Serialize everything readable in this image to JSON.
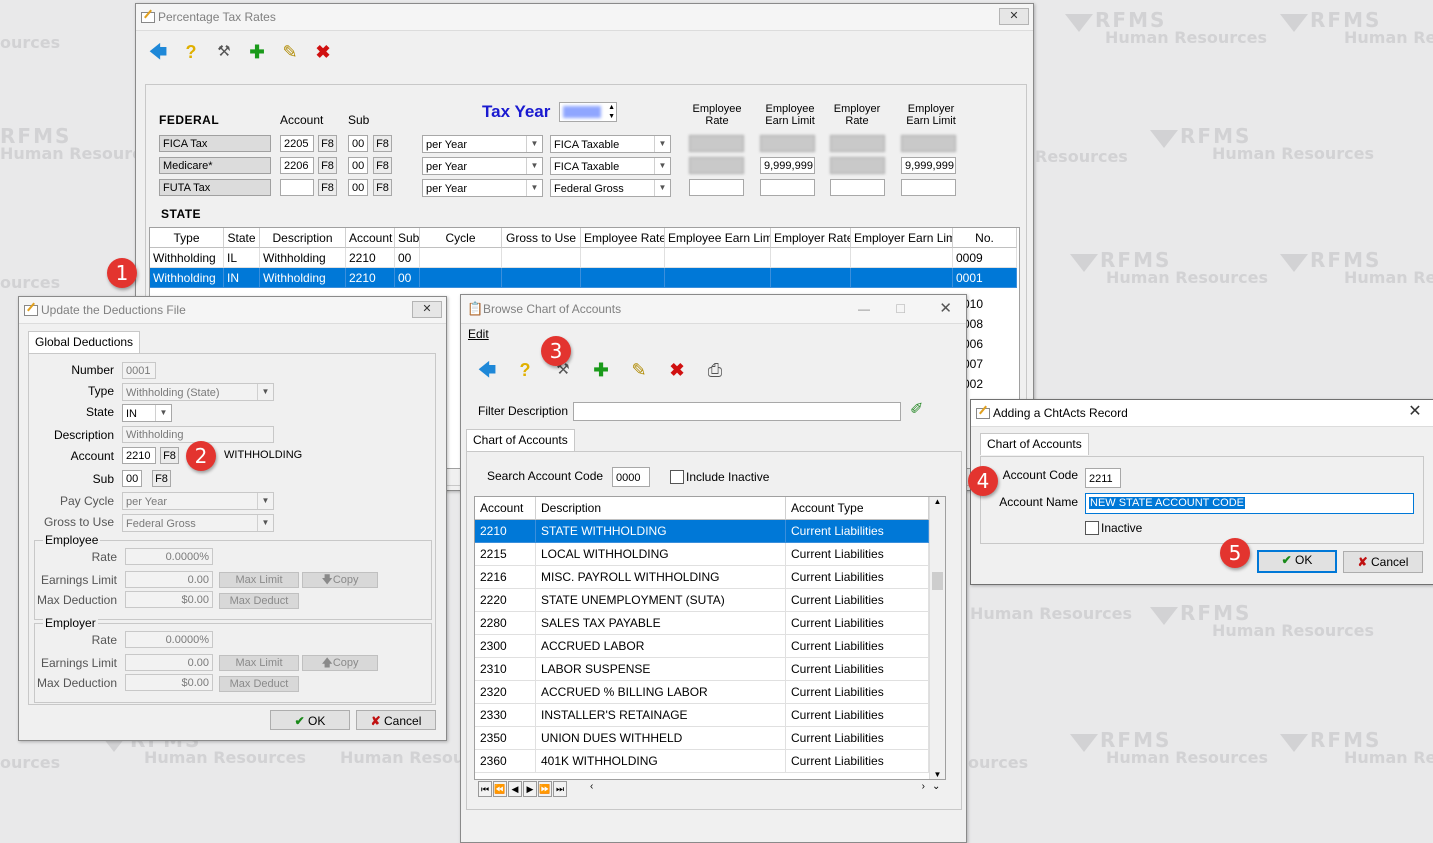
{
  "watermark": {
    "logo": "RFMS",
    "sub": "Human Resources",
    "sub_cut_left": "ources",
    "sub_cut_mid": "Resources",
    "sub_cut_right": "Human Res"
  },
  "tax_window": {
    "title": "Percentage Tax Rates",
    "federal": {
      "heading": "FEDERAL",
      "col_account": "Account",
      "col_sub": "Sub",
      "tax_year_label": "Tax Year",
      "col_emp_rate": "Employee Rate",
      "col_emp_earn": "Employee Earn Limit",
      "col_er_rate": "Employer Rate",
      "col_er_earn": "Employer Earn Limit",
      "f8": "F8",
      "rows": [
        {
          "name": "FICA Tax",
          "account": "2205",
          "sub": "00",
          "cycle": "per Year",
          "gross": "FICA Taxable",
          "emp_earn": "",
          "er_earn": ""
        },
        {
          "name": "Medicare*",
          "account": "2206",
          "sub": "00",
          "cycle": "per Year",
          "gross": "FICA Taxable",
          "emp_earn": "9,999,999",
          "er_earn": "9,999,999"
        },
        {
          "name": "FUTA Tax",
          "account": "",
          "sub": "00",
          "cycle": "per Year",
          "gross": "Federal Gross",
          "emp_earn": "",
          "er_earn": ""
        }
      ]
    },
    "state": {
      "heading": "STATE",
      "columns": [
        "Type",
        "State",
        "Description",
        "Account",
        "Sub",
        "Cycle",
        "Gross to Use",
        "Employee Rate",
        "Employee Earn Limit",
        "Employer Rate",
        "Employer Earn Limit",
        "No."
      ],
      "rows": [
        {
          "type": "Withholding",
          "state": "IL",
          "desc": "Withholding",
          "account": "2210",
          "sub": "00",
          "no": "0009"
        },
        {
          "type": "Withholding",
          "state": "IN",
          "desc": "Withholding",
          "account": "2210",
          "sub": "00",
          "no": "0001"
        }
      ],
      "partial_nos": [
        "010",
        "008",
        "006",
        "007",
        "002"
      ],
      "partial_left": "W"
    }
  },
  "deductions_window": {
    "title": "Update the Deductions File",
    "tab": "Global Deductions",
    "number_label": "Number",
    "number": "0001",
    "type_label": "Type",
    "type": "Withholding (State)",
    "state_label": "State",
    "state": "IN",
    "description_label": "Description",
    "description": "Withholding",
    "account_label": "Account",
    "account": "2210",
    "account_name": "WITHHOLDING",
    "sub_label": "Sub",
    "sub": "00",
    "pay_cycle_label": "Pay Cycle",
    "pay_cycle": "per Year",
    "gross_label": "Gross to Use",
    "gross": "Federal Gross",
    "employee_group": "Employee",
    "employer_group": "Employer",
    "rate_label": "Rate",
    "rate": "0.0000%",
    "earn_label": "Earnings Limit",
    "earn": "0.00",
    "maxded_label": "Max Deduction",
    "maxded": "$0.00",
    "max_limit_btn": "Max Limit",
    "copy_btn": "Copy",
    "max_deduct_btn": "Max Deduct",
    "ok": "OK",
    "cancel": "Cancel",
    "f8": "F8"
  },
  "coa_window": {
    "title": "Browse Chart of Accounts",
    "menu_edit": "Edit",
    "filter_label": "Filter Description",
    "filter_value": "",
    "tab": "Chart of Accounts",
    "search_label": "Search Account Code",
    "search_value": "0000",
    "include_inactive": "Include Inactive",
    "columns": [
      "Account",
      "Description",
      "Account Type"
    ],
    "rows": [
      {
        "account": "2210",
        "desc": "STATE WITHHOLDING",
        "type": "Current Liabilities"
      },
      {
        "account": "2215",
        "desc": "LOCAL WITHHOLDING",
        "type": "Current Liabilities"
      },
      {
        "account": "2216",
        "desc": "MISC. PAYROLL WITHHOLDING",
        "type": "Current Liabilities"
      },
      {
        "account": "2220",
        "desc": "STATE UNEMPLOYMENT (SUTA)",
        "type": "Current Liabilities"
      },
      {
        "account": "2280",
        "desc": "SALES TAX PAYABLE",
        "type": "Current Liabilities"
      },
      {
        "account": "2300",
        "desc": "ACCRUED LABOR",
        "type": "Current Liabilities"
      },
      {
        "account": "2310",
        "desc": "LABOR SUSPENSE",
        "type": "Current Liabilities"
      },
      {
        "account": "2320",
        "desc": "ACCRUED % BILLING LABOR",
        "type": "Current Liabilities"
      },
      {
        "account": "2330",
        "desc": "INSTALLER'S RETAINAGE",
        "type": "Current Liabilities"
      },
      {
        "account": "2350",
        "desc": "UNION DUES WITHHELD",
        "type": "Current Liabilities"
      },
      {
        "account": "2360",
        "desc": "401K WITHHOLDING",
        "type": "Current Liabilities"
      }
    ]
  },
  "add_window": {
    "title": "Adding a ChtActs Record",
    "tab": "Chart of Accounts",
    "code_label": "Account Code",
    "code": "2211",
    "name_label": "Account Name",
    "name": "NEW STATE ACCOUNT CODE",
    "inactive": "Inactive",
    "ok": "OK",
    "cancel": "Cancel"
  },
  "badges": [
    "1",
    "2",
    "3",
    "4",
    "5"
  ],
  "icons": [
    "back-arrow-icon",
    "help-icon",
    "tools-icon",
    "add-record-icon",
    "edit-record-icon",
    "delete-record-icon",
    "print-icon",
    "check-icon",
    "x-icon"
  ],
  "colors": {
    "selection": "#0078d7",
    "badge": "#e3342f",
    "tax_year": "#1a1ad0"
  }
}
